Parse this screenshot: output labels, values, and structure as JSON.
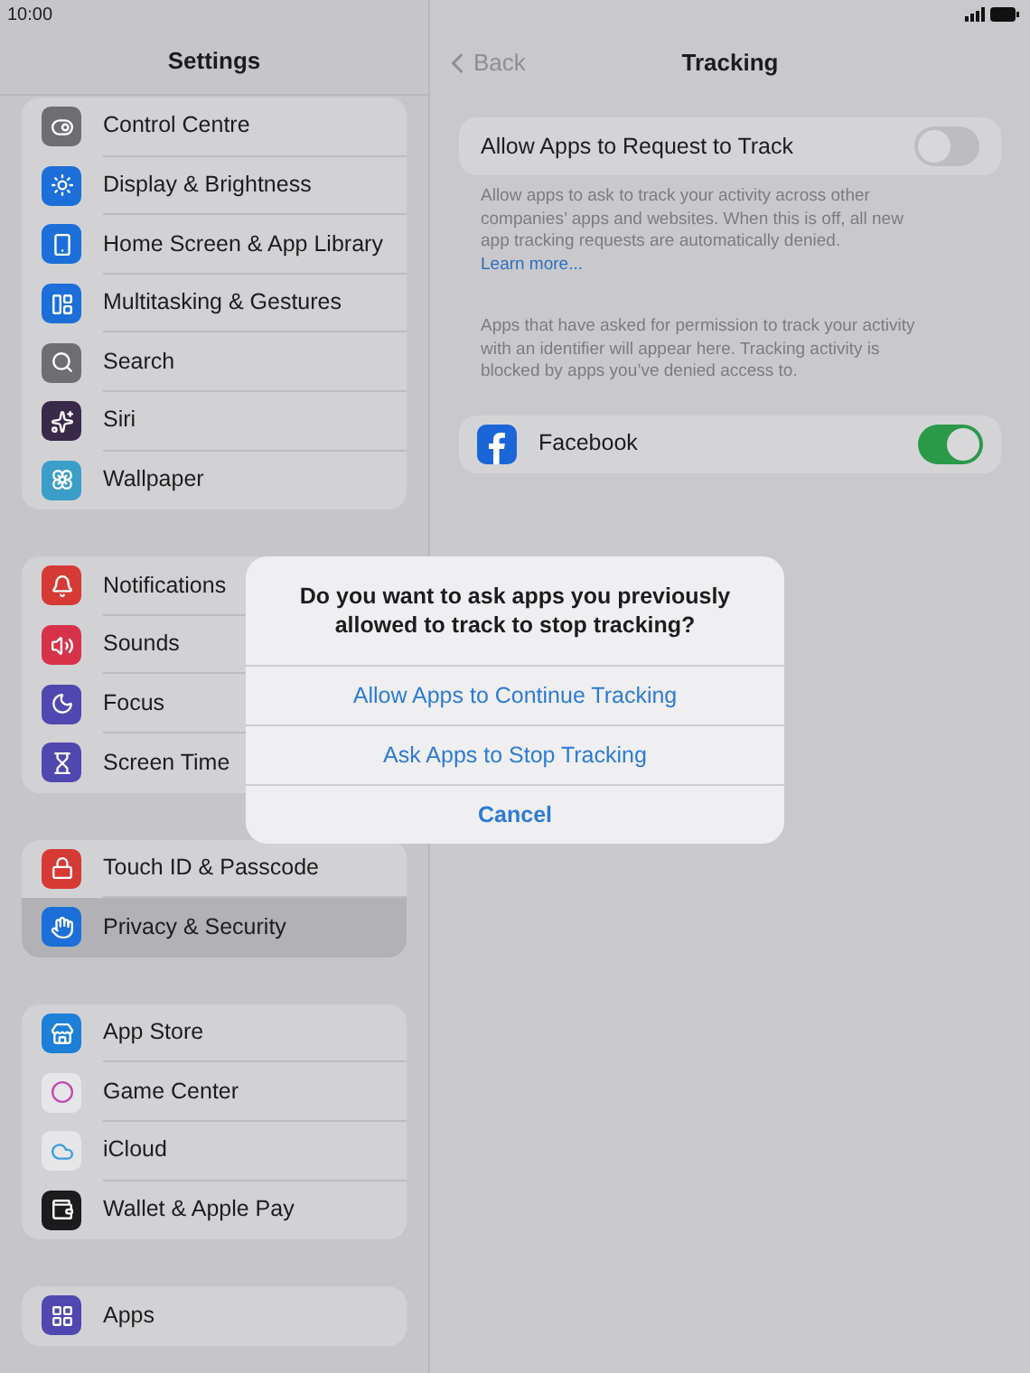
{
  "status_bar": {
    "time": "10:00"
  },
  "sidebar": {
    "title": "Settings",
    "groups": [
      {
        "items": [
          {
            "label": "Control Centre",
            "color": "#6e6e72",
            "selected": false
          },
          {
            "label": "Display & Brightness",
            "color": "#1c6fd8",
            "selected": false
          },
          {
            "label": "Home Screen & App Library",
            "color": "#1c6fd8",
            "selected": false
          },
          {
            "label": "Multitasking & Gestures",
            "color": "#1c6fd8",
            "selected": false
          },
          {
            "label": "Search",
            "color": "#6e6e72",
            "selected": false
          },
          {
            "label": "Siri",
            "color": "#3a2a4a",
            "selected": false
          },
          {
            "label": "Wallpaper",
            "color": "#3a9ec8",
            "selected": false
          }
        ]
      },
      {
        "items": [
          {
            "label": "Notifications",
            "color": "#d63a34",
            "selected": false
          },
          {
            "label": "Sounds",
            "color": "#d6334a",
            "selected": false
          },
          {
            "label": "Focus",
            "color": "#5147b0",
            "selected": false
          },
          {
            "label": "Screen Time",
            "color": "#5147b0",
            "selected": false
          }
        ]
      },
      {
        "items": [
          {
            "label": "Touch ID & Passcode",
            "color": "#d63a34",
            "selected": false
          },
          {
            "label": "Privacy & Security",
            "color": "#1c6fd8",
            "selected": true
          }
        ]
      },
      {
        "items": [
          {
            "label": "App Store",
            "color": "#1c7fd8",
            "selected": false
          },
          {
            "label": "Game Center",
            "color": "#e6e6e8",
            "selected": false
          },
          {
            "label": "iCloud",
            "color": "#e6e6e8",
            "selected": false
          },
          {
            "label": "Wallet & Apple Pay",
            "color": "#1c1c1e",
            "selected": false
          }
        ]
      },
      {
        "items": [
          {
            "label": "Apps",
            "color": "#5147b0",
            "selected": false
          }
        ]
      }
    ]
  },
  "detail": {
    "back": "Back",
    "title": "Tracking",
    "allow_row": {
      "label": "Allow Apps to Request to Track",
      "on": false
    },
    "allow_footer": {
      "text": "Allow apps to ask to track your activity across other companies’ apps and websites. When this is off, all new app tracking requests are automatically denied.",
      "link": "Learn more..."
    },
    "apps_header": "Apps that have asked for permission to track your activity with an identifier will appear here. Tracking activity is blocked by apps you’ve denied access to.",
    "apps": [
      {
        "name": "Facebook",
        "on": true
      }
    ]
  },
  "alert": {
    "message": "Do you want to ask apps you previously allowed to track to stop tracking?",
    "actions": [
      {
        "label": "Allow Apps to Continue Tracking",
        "kind": "default"
      },
      {
        "label": "Ask Apps to Stop Tracking",
        "kind": "default"
      },
      {
        "label": "Cancel",
        "kind": "cancel"
      }
    ]
  }
}
